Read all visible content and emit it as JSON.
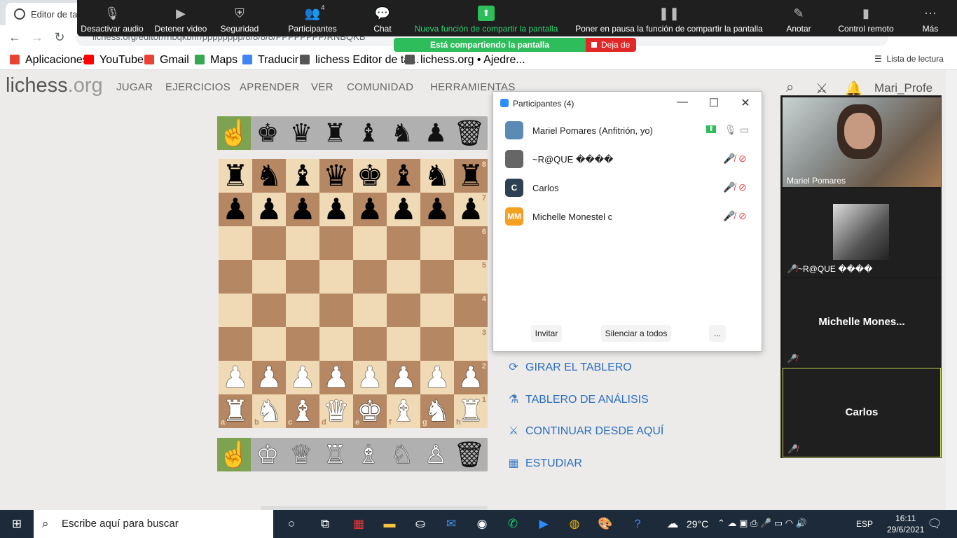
{
  "browser": {
    "tab_title": "Editor de tab",
    "url": "lichess.org/editor/rnbqkbnr/pppppppp/8/8/8/8/PPPPPPPP/RNBQKB",
    "bookmarks": [
      {
        "label": "Aplicaciones",
        "color": "#e94235"
      },
      {
        "label": "YouTube",
        "color": "#ff0000"
      },
      {
        "label": "Gmail",
        "color": "#ea4335"
      },
      {
        "label": "Maps",
        "color": "#34a853"
      },
      {
        "label": "Traducir",
        "color": "#4285f4"
      },
      {
        "label": "lichess Editor de ta...",
        "color": "#555555"
      },
      {
        "label": "lichess.org • Ajedre...",
        "color": "#555555"
      }
    ],
    "reading_list": "Lista de lectura"
  },
  "zoom_toolbar": {
    "items": [
      {
        "label": "Desactivar audio",
        "icon": "microphone-icon"
      },
      {
        "label": "Detener video",
        "icon": "camera-icon"
      },
      {
        "label": "Seguridad",
        "icon": "shield-icon"
      },
      {
        "label": "Participantes",
        "icon": "participants-icon",
        "count": "4"
      },
      {
        "label": "Chat",
        "icon": "chat-icon"
      },
      {
        "label": "Nueva función de compartir la pantalla",
        "icon": "share-screen-icon"
      },
      {
        "label": "Poner en pausa la función de compartir la pantalla",
        "icon": "pause-icon"
      },
      {
        "label": "Anotar",
        "icon": "pencil-icon"
      },
      {
        "label": "Control remoto",
        "icon": "mouse-icon"
      },
      {
        "label": "Más",
        "icon": "more-icon"
      }
    ],
    "share_status": "Está compartiendo la pantalla",
    "stop_label": "Deja de",
    "accent_green": "#2dbd5a",
    "stop_red": "#e02828"
  },
  "lichess": {
    "logo_main": "lichess",
    "logo_tld": ".org",
    "menu": [
      "JUGAR",
      "EJERCICIOS",
      "APRENDER",
      "VER",
      "COMUNIDAD",
      "HERRAMIENTAS"
    ],
    "username": "Mari_Profe",
    "spare_black": [
      "☝",
      "♚",
      "♛",
      "♜",
      "♝",
      "♞",
      "♟",
      "🗑"
    ],
    "spare_white": [
      "☝",
      "♔",
      "♕",
      "♖",
      "♗",
      "♘",
      "♙",
      "🗑"
    ],
    "board_rows": [
      "rnbqkbnr",
      "pppppppp",
      "........",
      "........",
      "........",
      "........",
      "PPPPPPPP",
      "RNBQKBNR"
    ],
    "ranks": [
      "8",
      "7",
      "6",
      "5",
      "4",
      "3",
      "2",
      "1"
    ],
    "files": [
      "a",
      "b",
      "c",
      "d",
      "e",
      "f",
      "g",
      "h"
    ],
    "actions": [
      {
        "label": "GIRAR EL TABLERO",
        "icon": "flip-icon"
      },
      {
        "label": "TABLERO DE ANÁLISIS",
        "icon": "microscope-icon"
      },
      {
        "label": "CONTINUAR DESDE AQUÍ",
        "icon": "swords-icon"
      },
      {
        "label": "ESTUDIAR",
        "icon": "study-icon"
      }
    ]
  },
  "participants": {
    "title": "Participantes (4)",
    "list": [
      {
        "name": "Mariel Pomares (Anfitrión, yo)",
        "avatar": "",
        "avatar_color": "#5b8bb5"
      },
      {
        "name": "~R@QUE ����",
        "avatar": "",
        "avatar_color": "#666666"
      },
      {
        "name": "Carlos",
        "avatar": "C",
        "avatar_color": "#2e4053"
      },
      {
        "name": "Michelle Monestel c",
        "avatar": "MM",
        "avatar_color": "#f4a020"
      }
    ],
    "buttons": [
      "Invitar",
      "Silenciar a todos",
      "..."
    ]
  },
  "video_panel": {
    "tiles": [
      "Mariel Pomares",
      "~R@QUE ����",
      "Michelle  Mones...",
      "Carlos"
    ]
  },
  "taskbar": {
    "search_placeholder": "Escribe aquí para buscar",
    "temperature": "29°C",
    "language": "ESP",
    "time": "16:11",
    "date": "29/6/2021"
  }
}
